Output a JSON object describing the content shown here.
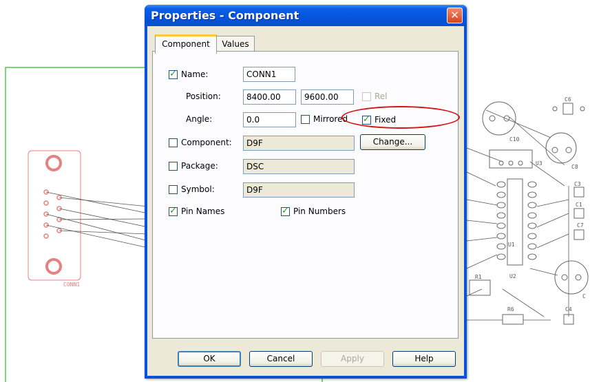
{
  "dialog": {
    "title": "Properties - Component",
    "close_glyph": "✕",
    "tabs": [
      {
        "label": "Component",
        "active": true
      },
      {
        "label": "Values",
        "active": false
      }
    ],
    "fields": {
      "name": {
        "label": "Name:",
        "checked": true,
        "value": "CONN1"
      },
      "position": {
        "label": "Position:",
        "x": "8400.00",
        "y": "9600.00"
      },
      "rel": {
        "label": "Rel",
        "checked": false,
        "enabled": false
      },
      "angle": {
        "label": "Angle:",
        "value": "0.0"
      },
      "mirrored": {
        "label": "Mirrored",
        "checked": false
      },
      "fixed": {
        "label": "Fixed",
        "checked": true
      },
      "component": {
        "label": "Component:",
        "checked": false,
        "value": "D9F"
      },
      "change_button": "Change...",
      "package": {
        "label": "Package:",
        "checked": false,
        "value": "DSC"
      },
      "symbol": {
        "label": "Symbol:",
        "checked": false,
        "value": "D9F"
      },
      "pin_names": {
        "label": "Pin Names",
        "checked": true
      },
      "pin_numbers": {
        "label": "Pin Numbers",
        "checked": true
      }
    },
    "buttons": {
      "ok": "OK",
      "cancel": "Cancel",
      "apply": "Apply",
      "help": "Help"
    }
  },
  "background": {
    "connector_label": "CONN1",
    "component_labels": [
      "C6",
      "C10",
      "U3",
      "C8",
      "C3",
      "C1",
      "C7",
      "U1",
      "R1",
      "U2",
      "R6",
      "C4",
      "C"
    ]
  },
  "colors": {
    "board_outline": "#22c122",
    "connector": "#e88080",
    "traces": "#555555",
    "titlebar": "#0554dc",
    "annotation": "#d41313"
  }
}
